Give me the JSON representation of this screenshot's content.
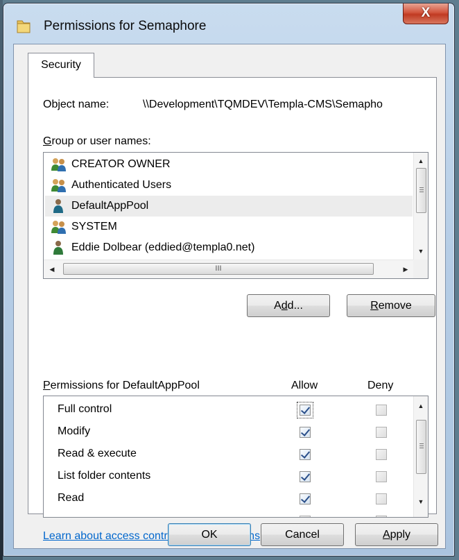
{
  "window": {
    "title": "Permissions for Semaphore",
    "close_label": "X"
  },
  "tabs": [
    {
      "label": "Security",
      "selected": true
    }
  ],
  "object": {
    "label": "Object name:",
    "value": "\\\\Development\\TQMDEV\\Templa-CMS\\Semapho"
  },
  "groups": {
    "label_mnemonic": "G",
    "label_rest": "roup or user names:",
    "items": [
      {
        "name": "CREATOR OWNER",
        "icon": "group-icon"
      },
      {
        "name": "Authenticated Users",
        "icon": "group-icon"
      },
      {
        "name": "DefaultAppPool",
        "icon": "user-icon",
        "selected": true
      },
      {
        "name": "SYSTEM",
        "icon": "group-icon"
      },
      {
        "name": "Eddie Dolbear (eddied@templa0.net)",
        "icon": "user-icon"
      }
    ],
    "hscroll_grip": "III"
  },
  "buttons": {
    "add_pre": "A",
    "add_mnemonic": "d",
    "add_post": "d...",
    "remove_mnemonic": "R",
    "remove_rest": "emove",
    "ok": "OK",
    "cancel": "Cancel",
    "apply_mnemonic": "A",
    "apply_rest": "pply"
  },
  "permissions": {
    "header_mnemonic": "P",
    "header_rest": "ermissions for DefaultAppPool",
    "allow_label": "Allow",
    "deny_label": "Deny",
    "rows": [
      {
        "name": "Full control",
        "allow": true,
        "deny": false
      },
      {
        "name": "Modify",
        "allow": true,
        "deny": false
      },
      {
        "name": "Read & execute",
        "allow": true,
        "deny": false
      },
      {
        "name": "List folder contents",
        "allow": true,
        "deny": false
      },
      {
        "name": "Read",
        "allow": true,
        "deny": false
      }
    ]
  },
  "learn_link": "Learn about access control and permissions",
  "colors": {
    "link": "#0066cc",
    "close_button": "#c03a22",
    "selected_row": "#ececec"
  }
}
